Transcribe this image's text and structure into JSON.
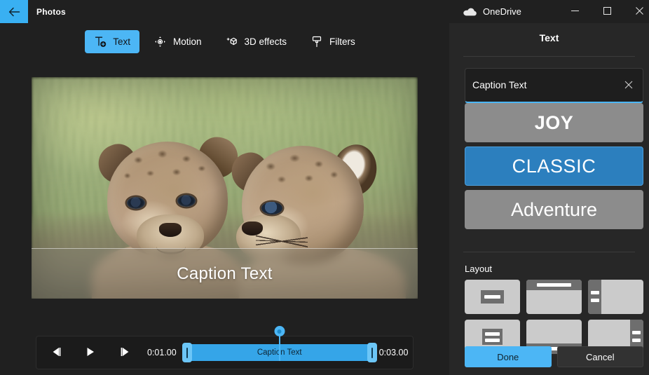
{
  "titlebar": {
    "back_icon": "back-arrow-icon",
    "app_name": "Photos",
    "onedrive_label": "OneDrive",
    "onedrive_icon": "cloud-icon",
    "minimize_icon": "minimize-icon",
    "maximize_icon": "maximize-icon",
    "close_icon": "close-icon"
  },
  "toolbar": {
    "items": [
      {
        "label": "Text",
        "icon": "text-add-icon",
        "active": true
      },
      {
        "label": "Motion",
        "icon": "motion-icon",
        "active": false
      },
      {
        "label": "3D effects",
        "icon": "3d-effects-icon",
        "active": false
      },
      {
        "label": "Filters",
        "icon": "filters-brush-icon",
        "active": false
      }
    ]
  },
  "preview": {
    "caption_overlay": "Caption Text",
    "image_description": "Two cougar cubs in grass"
  },
  "timeline": {
    "prev_frame_icon": "previous-frame-icon",
    "play_icon": "play-icon",
    "next_frame_icon": "next-frame-icon",
    "start_time": "0:01.00",
    "end_time": "0:03.00",
    "clip_label": "Caption Text"
  },
  "panel": {
    "title": "Text",
    "caption_input_value": "Caption Text",
    "caption_input_placeholder": "Caption Text",
    "clear_icon": "close-icon",
    "styles": [
      {
        "name": "JOY",
        "selected": false
      },
      {
        "name": "CLASSIC",
        "selected": true
      },
      {
        "name": "Adventure",
        "selected": false
      }
    ],
    "layout_label": "Layout",
    "layouts": [
      {
        "name": "centered-box"
      },
      {
        "name": "top-bar"
      },
      {
        "name": "left-column"
      },
      {
        "name": "centered-stacked"
      },
      {
        "name": "bottom-bar"
      },
      {
        "name": "right-column"
      }
    ],
    "done_label": "Done",
    "cancel_label": "Cancel"
  },
  "colors": {
    "accent": "#4cb6f5",
    "selected_style": "#2c7fbe",
    "panel_bg": "#272727",
    "app_bg": "#202020"
  }
}
